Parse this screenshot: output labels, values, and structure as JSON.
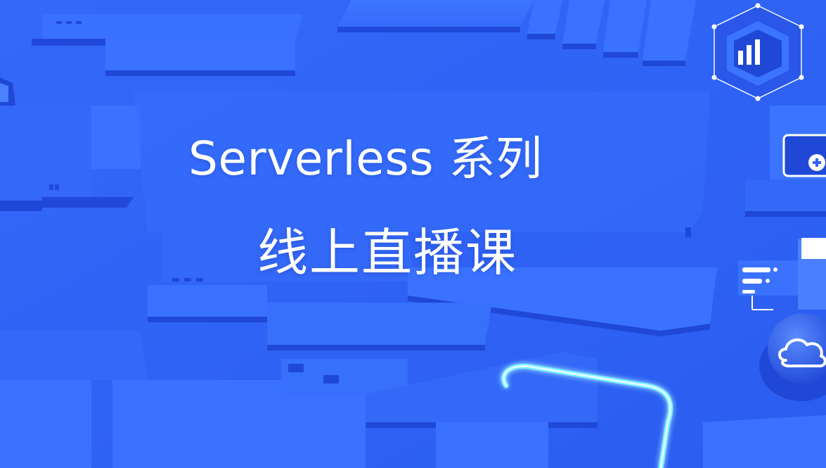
{
  "banner": {
    "title_line1": "Serverless 系列",
    "title_line2": "线上直播课"
  },
  "colors": {
    "background": "#2f63f5",
    "plate_top": "#3a72ff",
    "plate_side": "#1f48d6",
    "plate_shadow": "#2453e6",
    "glow": "#7ef3ff",
    "text": "#ffffff"
  },
  "icons": [
    "bar-chart-hex-icon",
    "plus-box-icon",
    "server-rack-icon",
    "cloud-icon",
    "glowing-cable-icon"
  ]
}
